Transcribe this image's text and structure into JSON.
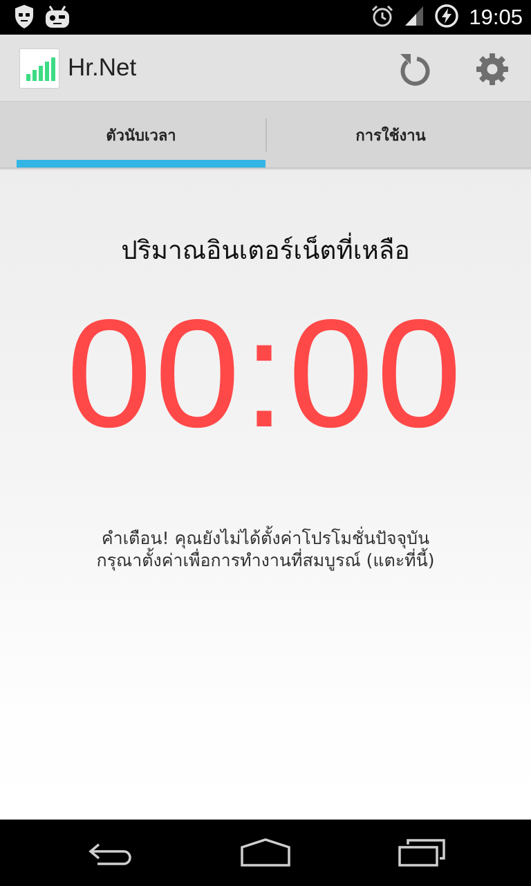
{
  "status_bar": {
    "time": "19:05",
    "left_icons": [
      "privacy-guard-icon",
      "cyanogenmod-icon"
    ],
    "right_icons": [
      "alarm-icon",
      "signal-icon",
      "battery-charging-icon"
    ]
  },
  "action_bar": {
    "app_title": "Hr.Net",
    "app_icon": "signal-bars-icon",
    "actions": [
      "refresh-icon",
      "settings-icon"
    ]
  },
  "tabs": [
    {
      "label": "ตัวนับเวลา",
      "selected": true
    },
    {
      "label": "การใช้งาน",
      "selected": false
    }
  ],
  "main": {
    "heading": "ปริมาณอินเตอร์เน็ตที่เหลือ",
    "timer": "00:00",
    "warning_line1": "คำเตือน! คุณยังไม่ได้ตั้งค่าโปรโมชั่นปัจจุบัน",
    "warning_line2": "กรุณาตั้งค่าเพื่อการทำงานที่สมบูรณ์ (แตะที่นี้)"
  },
  "colors": {
    "accent": "#33b5e5",
    "timer": "#ff4848",
    "icon_green": "#3ddc84"
  },
  "nav_bar": [
    "back-icon",
    "home-icon",
    "recents-icon"
  ]
}
